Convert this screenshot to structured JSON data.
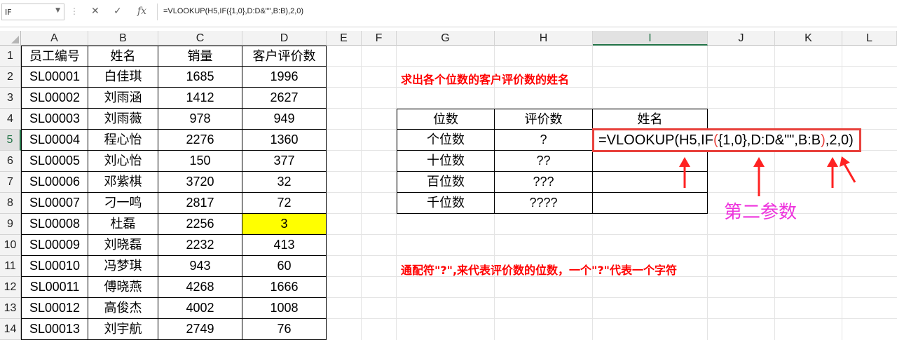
{
  "formula_bar": {
    "name_box": "IF",
    "formula": "=VLOOKUP(H5,IF({1,0},D:D&\"\",B:B),2,0)"
  },
  "columns": [
    "A",
    "B",
    "C",
    "D",
    "E",
    "F",
    "G",
    "H",
    "I",
    "J",
    "K",
    "L"
  ],
  "selected_column": "I",
  "rows": [
    "1",
    "2",
    "3",
    "4",
    "5",
    "6",
    "7",
    "8",
    "9",
    "10",
    "11",
    "12",
    "13",
    "14"
  ],
  "selected_row": "5",
  "table_main": {
    "headers": [
      "员工编号",
      "姓名",
      "销量",
      "客户评价数"
    ],
    "rows": [
      [
        "SL00001",
        "白佳琪",
        "1685",
        "1996"
      ],
      [
        "SL00002",
        "刘雨涵",
        "1412",
        "2627"
      ],
      [
        "SL00003",
        "刘雨薇",
        "978",
        "949"
      ],
      [
        "SL00004",
        "程心怡",
        "2276",
        "1360"
      ],
      [
        "SL00005",
        "刘心怡",
        "150",
        "377"
      ],
      [
        "SL00006",
        "邓紫棋",
        "3720",
        "32"
      ],
      [
        "SL00007",
        "刁一鸣",
        "2817",
        "72"
      ],
      [
        "SL00008",
        "杜磊",
        "2256",
        "3"
      ],
      [
        "SL00009",
        "刘晓磊",
        "2232",
        "413"
      ],
      [
        "SL00010",
        "冯梦琪",
        "943",
        "60"
      ],
      [
        "SL00011",
        "傅晓燕",
        "4268",
        "1666"
      ],
      [
        "SL00012",
        "高俊杰",
        "4002",
        "1008"
      ],
      [
        "SL00013",
        "刘宇航",
        "2749",
        "76"
      ]
    ],
    "highlight_color": "#ffff00"
  },
  "table_lookup": {
    "headers": [
      "位数",
      "评价数",
      "姓名"
    ],
    "rows": [
      [
        "个位数",
        "?",
        ""
      ],
      [
        "十位数",
        "??",
        ""
      ],
      [
        "百位数",
        "???",
        ""
      ],
      [
        "千位数",
        "????",
        ""
      ]
    ]
  },
  "editing_formula": {
    "part1": "=VLOOKUP(H5,IF",
    "part2": "(",
    "part3": "{1,0},D:D&\"\",B:B",
    "part4": ")",
    "part5": ",2,0)"
  },
  "notes": {
    "title": "求出各个位数的客户评价数的姓名",
    "second_param": "第二参数",
    "wildcard": "通配符\"?\",来代表评价数的位数，一个\"?\"代表一个字符"
  },
  "colors": {
    "accent_green": "#217346",
    "note_red": "#ff0000",
    "box_red": "#e8413c",
    "caption_magenta": "#ee33dd"
  }
}
